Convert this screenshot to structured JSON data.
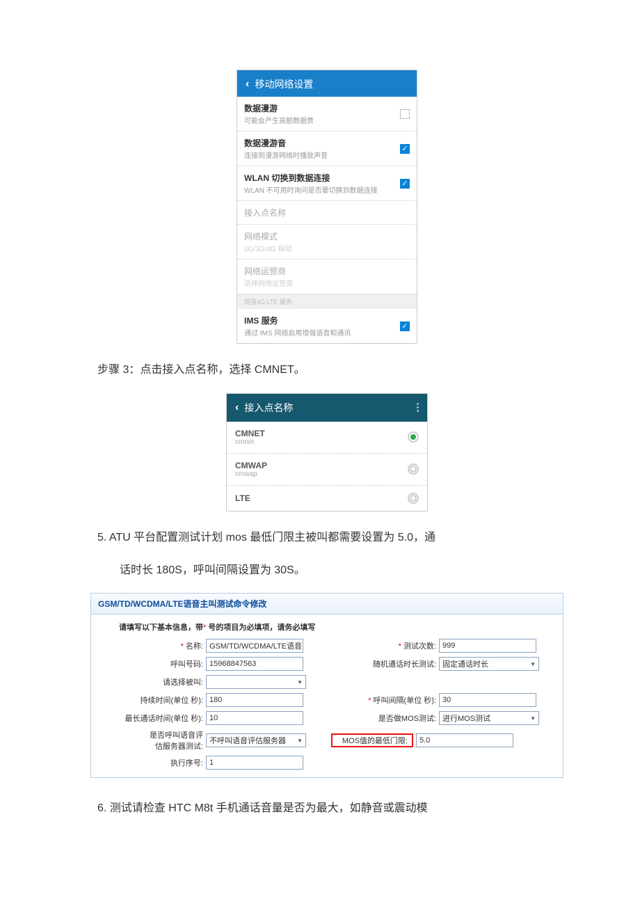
{
  "mobile1": {
    "header": "移动网络设置",
    "rows": [
      {
        "main": "数据漫游",
        "sub": "可能会产生高额数据费",
        "checked": false
      },
      {
        "main": "数据漫游音",
        "sub": "连接到漫游网络时播放声音",
        "checked": true
      },
      {
        "main": "WLAN 切换到数据连接",
        "sub": "WLAN 不可用时询问是否要切换到数据连接",
        "checked": true
      },
      {
        "main": "接入点名称",
        "sub": "",
        "checked": null,
        "disabled": true
      },
      {
        "main": "网络模式",
        "sub": "2G/3G/4G 自动",
        "checked": null,
        "disabled": true
      },
      {
        "main": "网络运营商",
        "sub": "选择网络运营商",
        "checked": null,
        "disabled": true
      }
    ],
    "section_small": "增强4G LTE 服务",
    "ims": {
      "main": "IMS 服务",
      "sub": "通过 IMS 网络启用增强语音和通讯",
      "checked": true
    }
  },
  "step3_text": "步骤 3：点击接入点名称，选择 CMNET。",
  "mobile2": {
    "header": "接入点名称",
    "rows": [
      {
        "main": "CMNET",
        "sub": "cmnet",
        "selected": true
      },
      {
        "main": "CMWAP",
        "sub": "cmwap",
        "selected": false
      },
      {
        "main": "LTE",
        "sub": "",
        "selected": false
      }
    ]
  },
  "item5_line1": "5.  ATU 平台配置测试计划 mos 最低门限主被叫都需要设置为 5.0，通",
  "item5_line2": "话时长 180S，呼叫间隔设置为 30S。",
  "form": {
    "title": "GSM/TD/WCDMA/LTE语音主叫测试命令修改",
    "subtitle_pre": "请填写以下基本信息，带",
    "subtitle_star": "*",
    "subtitle_post": " 号的项目为必填项，请务必填写",
    "fields": {
      "name_label": "名称:",
      "name_value": "GSM/TD/WCDMA/LTE语音",
      "test_count_label": "测试次数:",
      "test_count_value": "999",
      "call_num_label": "呼叫号码:",
      "call_num_value": "15968847563",
      "random_dur_label": "随机通话时长测试:",
      "random_dur_value": "固定通话时长",
      "select_called_label": "请选择被叫:",
      "select_called_value": "",
      "duration_label": "持续时间(单位 秒):",
      "duration_value": "180",
      "interval_label": "呼叫间隔(单位 秒):",
      "interval_value": "30",
      "max_dur_label": "最长通话时间(单位 秒):",
      "max_dur_value": "10",
      "do_mos_label": "是否做MOS测试:",
      "do_mos_value": "进行MOS测试",
      "voice_eval_label1": "是否呼叫语音评",
      "voice_eval_label2": "估服务器测试:",
      "voice_eval_value": "不呼叫语音评估服务器",
      "mos_min_label": "MOS值的最低门限:",
      "mos_min_value": "5.0",
      "exec_seq_label": "执行序号:",
      "exec_seq_value": "1"
    }
  },
  "item6_text": "6.  测试请检查 HTC M8t 手机通话音量是否为最大，如静音或震动模"
}
